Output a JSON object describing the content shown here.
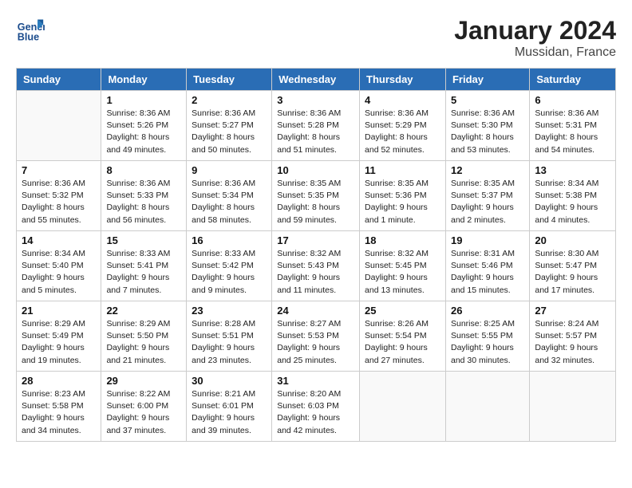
{
  "header": {
    "logo_line1": "General",
    "logo_line2": "Blue",
    "month_title": "January 2024",
    "location": "Mussidan, France"
  },
  "days_of_week": [
    "Sunday",
    "Monday",
    "Tuesday",
    "Wednesday",
    "Thursday",
    "Friday",
    "Saturday"
  ],
  "weeks": [
    [
      {
        "day": "",
        "info": ""
      },
      {
        "day": "1",
        "info": "Sunrise: 8:36 AM\nSunset: 5:26 PM\nDaylight: 8 hours\nand 49 minutes."
      },
      {
        "day": "2",
        "info": "Sunrise: 8:36 AM\nSunset: 5:27 PM\nDaylight: 8 hours\nand 50 minutes."
      },
      {
        "day": "3",
        "info": "Sunrise: 8:36 AM\nSunset: 5:28 PM\nDaylight: 8 hours\nand 51 minutes."
      },
      {
        "day": "4",
        "info": "Sunrise: 8:36 AM\nSunset: 5:29 PM\nDaylight: 8 hours\nand 52 minutes."
      },
      {
        "day": "5",
        "info": "Sunrise: 8:36 AM\nSunset: 5:30 PM\nDaylight: 8 hours\nand 53 minutes."
      },
      {
        "day": "6",
        "info": "Sunrise: 8:36 AM\nSunset: 5:31 PM\nDaylight: 8 hours\nand 54 minutes."
      }
    ],
    [
      {
        "day": "7",
        "info": "Sunrise: 8:36 AM\nSunset: 5:32 PM\nDaylight: 8 hours\nand 55 minutes."
      },
      {
        "day": "8",
        "info": "Sunrise: 8:36 AM\nSunset: 5:33 PM\nDaylight: 8 hours\nand 56 minutes."
      },
      {
        "day": "9",
        "info": "Sunrise: 8:36 AM\nSunset: 5:34 PM\nDaylight: 8 hours\nand 58 minutes."
      },
      {
        "day": "10",
        "info": "Sunrise: 8:35 AM\nSunset: 5:35 PM\nDaylight: 8 hours\nand 59 minutes."
      },
      {
        "day": "11",
        "info": "Sunrise: 8:35 AM\nSunset: 5:36 PM\nDaylight: 9 hours\nand 1 minute."
      },
      {
        "day": "12",
        "info": "Sunrise: 8:35 AM\nSunset: 5:37 PM\nDaylight: 9 hours\nand 2 minutes."
      },
      {
        "day": "13",
        "info": "Sunrise: 8:34 AM\nSunset: 5:38 PM\nDaylight: 9 hours\nand 4 minutes."
      }
    ],
    [
      {
        "day": "14",
        "info": "Sunrise: 8:34 AM\nSunset: 5:40 PM\nDaylight: 9 hours\nand 5 minutes."
      },
      {
        "day": "15",
        "info": "Sunrise: 8:33 AM\nSunset: 5:41 PM\nDaylight: 9 hours\nand 7 minutes."
      },
      {
        "day": "16",
        "info": "Sunrise: 8:33 AM\nSunset: 5:42 PM\nDaylight: 9 hours\nand 9 minutes."
      },
      {
        "day": "17",
        "info": "Sunrise: 8:32 AM\nSunset: 5:43 PM\nDaylight: 9 hours\nand 11 minutes."
      },
      {
        "day": "18",
        "info": "Sunrise: 8:32 AM\nSunset: 5:45 PM\nDaylight: 9 hours\nand 13 minutes."
      },
      {
        "day": "19",
        "info": "Sunrise: 8:31 AM\nSunset: 5:46 PM\nDaylight: 9 hours\nand 15 minutes."
      },
      {
        "day": "20",
        "info": "Sunrise: 8:30 AM\nSunset: 5:47 PM\nDaylight: 9 hours\nand 17 minutes."
      }
    ],
    [
      {
        "day": "21",
        "info": "Sunrise: 8:29 AM\nSunset: 5:49 PM\nDaylight: 9 hours\nand 19 minutes."
      },
      {
        "day": "22",
        "info": "Sunrise: 8:29 AM\nSunset: 5:50 PM\nDaylight: 9 hours\nand 21 minutes."
      },
      {
        "day": "23",
        "info": "Sunrise: 8:28 AM\nSunset: 5:51 PM\nDaylight: 9 hours\nand 23 minutes."
      },
      {
        "day": "24",
        "info": "Sunrise: 8:27 AM\nSunset: 5:53 PM\nDaylight: 9 hours\nand 25 minutes."
      },
      {
        "day": "25",
        "info": "Sunrise: 8:26 AM\nSunset: 5:54 PM\nDaylight: 9 hours\nand 27 minutes."
      },
      {
        "day": "26",
        "info": "Sunrise: 8:25 AM\nSunset: 5:55 PM\nDaylight: 9 hours\nand 30 minutes."
      },
      {
        "day": "27",
        "info": "Sunrise: 8:24 AM\nSunset: 5:57 PM\nDaylight: 9 hours\nand 32 minutes."
      }
    ],
    [
      {
        "day": "28",
        "info": "Sunrise: 8:23 AM\nSunset: 5:58 PM\nDaylight: 9 hours\nand 34 minutes."
      },
      {
        "day": "29",
        "info": "Sunrise: 8:22 AM\nSunset: 6:00 PM\nDaylight: 9 hours\nand 37 minutes."
      },
      {
        "day": "30",
        "info": "Sunrise: 8:21 AM\nSunset: 6:01 PM\nDaylight: 9 hours\nand 39 minutes."
      },
      {
        "day": "31",
        "info": "Sunrise: 8:20 AM\nSunset: 6:03 PM\nDaylight: 9 hours\nand 42 minutes."
      },
      {
        "day": "",
        "info": ""
      },
      {
        "day": "",
        "info": ""
      },
      {
        "day": "",
        "info": ""
      }
    ]
  ]
}
